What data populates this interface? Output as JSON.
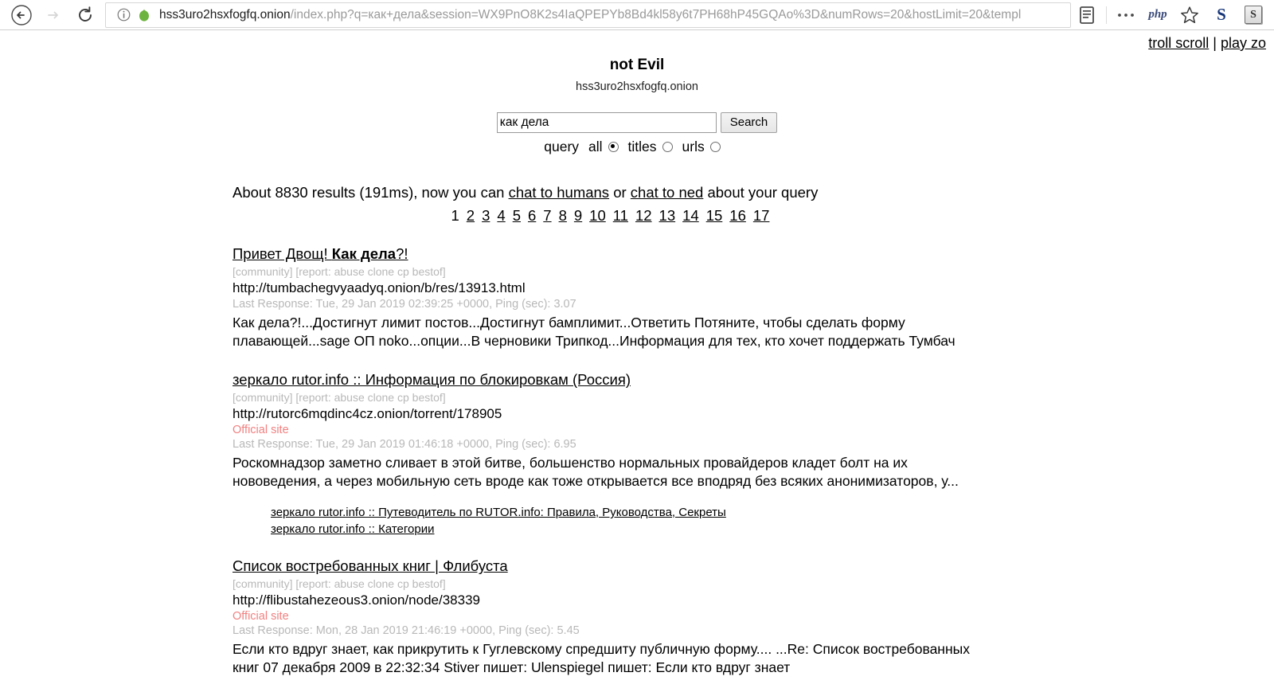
{
  "browser": {
    "back_title": "Back",
    "forward_title": "Forward",
    "reload_title": "Reload",
    "info_icon": "info-icon",
    "onion_icon": "onion-icon",
    "url_host": "hss3uro2hsxfogfq.onion",
    "url_path": "/index.php?q=как+дела&session=WX9PnO8K2s4IaQPEPYb8Bd4kl58y6t7PH68hP45GQAo%3D&numRows=20&hostLimit=20&templ",
    "toolbar": {
      "reader_icon": "reader-view-icon",
      "overflow_icon": "more-options-icon",
      "php_label": "php",
      "bookmark_icon": "bookmark-star-icon",
      "ext_s_label": "S",
      "ext_sbox_label": "S"
    }
  },
  "page": {
    "top_links": [
      {
        "label": "troll scroll"
      },
      {
        "label": "play zo"
      }
    ],
    "top_links_separator": " | ",
    "site_title": "not Evil",
    "site_subtitle": "hss3uro2hsxfogfq.onion",
    "search": {
      "value": "как дела",
      "placeholder": "",
      "button_label": "Search",
      "query_label": "query",
      "options": [
        {
          "label": "all",
          "checked": true
        },
        {
          "label": "titles",
          "checked": false
        },
        {
          "label": "urls",
          "checked": false
        }
      ]
    },
    "summary": {
      "prefix": "About 8830 results (191ms), now you can ",
      "link1": "chat to humans",
      "middle": " or ",
      "link2": "chat to ned",
      "suffix": " about your query",
      "result_count": "8830",
      "time_ms": "191ms"
    },
    "pagination": {
      "current": "1",
      "pages": [
        "2",
        "3",
        "4",
        "5",
        "6",
        "7",
        "8",
        "9",
        "10",
        "11",
        "12",
        "13",
        "14",
        "15",
        "16",
        "17"
      ]
    },
    "results": [
      {
        "title_plain": "Привет Двощ! ",
        "title_bold": "Как дела",
        "title_tail": "?!",
        "tags": "[community] [report: abuse clone cp bestof]",
        "url": "http://tumbachegvyaadyq.onion/b/res/13913.html",
        "official": "",
        "meta": "Last Response: Tue, 29 Jan 2019 02:39:25 +0000, Ping (sec): 3.07",
        "snippet": "Как дела?!...Достигнут лимит постов...Достигнут бамплимит...Ответить Потяните, чтобы сделать форму плавающей...sage ОП noko...опции...В черновики Трипкод...Информация для тех, кто хочет поддержать Тумбач",
        "sublinks": []
      },
      {
        "title_plain": "зеркало rutor.info :: Информация по блокировкам (Россия)",
        "title_bold": "",
        "title_tail": "",
        "tags": "[community] [report: abuse clone cp bestof]",
        "url": "http://rutorc6mqdinc4cz.onion/torrent/178905",
        "official": "Official site",
        "meta": "Last Response: Tue, 29 Jan 2019 01:46:18 +0000, Ping (sec): 6.95",
        "snippet": "Роскомнадзор заметно сливает в этой битве, большенство нормальных провайдеров кладет болт на их нововедения, а через мобильную сеть вроде как тоже открывается все вподряд без всяких анонимизаторов, у...",
        "sublinks": [
          "зеркало rutor.info :: Путеводитель по RUTOR.info: Правила, Руководства, Секреты",
          "зеркало rutor.info :: Категории"
        ]
      },
      {
        "title_plain": "Список востребованных книг | Флибуста",
        "title_bold": "",
        "title_tail": "",
        "tags": "[community] [report: abuse clone cp bestof]",
        "url": "http://flibustahezeous3.onion/node/38339",
        "official": "Official site",
        "meta": "Last Response: Mon, 28 Jan 2019 21:46:19 +0000, Ping (sec): 5.45",
        "snippet": "Если кто вдруг знает, как прикрутить к Гуглевскому спредшиту публичную форму.... ...Re: Список востребованных книг  07 декабря 2009  в 22:32:34 Stiver пишет:   Ulenspiegel пишет:   Если кто вдруг знает",
        "sublinks": []
      }
    ]
  },
  "colors": {
    "link": "#000000",
    "meta_grey": "#b8b8b8",
    "official_red": "#f28080",
    "url_host_dark": "#1d1d1d",
    "url_path_grey": "#9a9a9a",
    "onion_green": "#6cb33f"
  }
}
